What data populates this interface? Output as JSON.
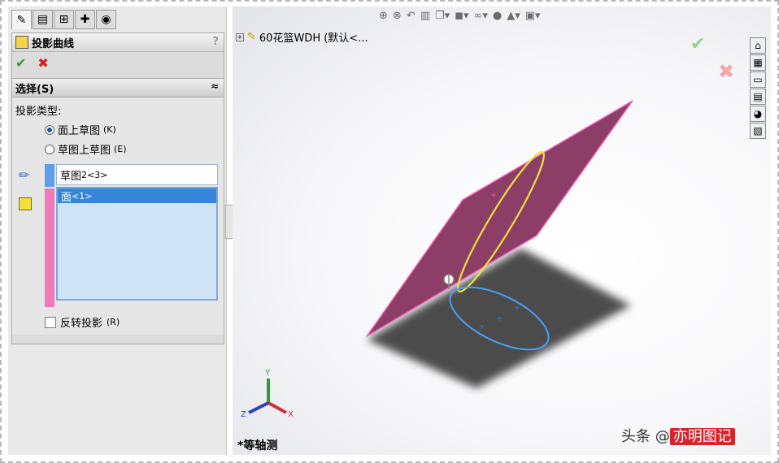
{
  "panel": {
    "title": "投影曲线",
    "help": "?",
    "ok_glyph": "✔",
    "cancel_glyph": "✖",
    "section_title": "选择(S)",
    "collapse_glyph": "≈",
    "type_label": "投影类型:",
    "radio1": {
      "label": "面上草图",
      "key": "(K)",
      "checked": true
    },
    "radio2": {
      "label": "草图上草图",
      "key": "(E)",
      "checked": false
    },
    "sketch_value": "草图",
    "sketch_suffix": "2<3>",
    "face_value": "面",
    "face_suffix": "<1>",
    "reverse_label": "反转投影",
    "reverse_key": "(R)"
  },
  "viewport": {
    "tree_label": "60花篮WDH  (默认<...",
    "view_name": "*等轴测",
    "watermark_prefix": "头条 @",
    "watermark_stamp": "亦明图记",
    "triad": {
      "x": "X",
      "y": "Y",
      "z": "Z"
    },
    "accent_colors": {
      "plane": "#8c3e66",
      "plane_edge": "#f067b8",
      "ellipse": "#f2e238",
      "sketch": "#4a9ef5"
    }
  }
}
